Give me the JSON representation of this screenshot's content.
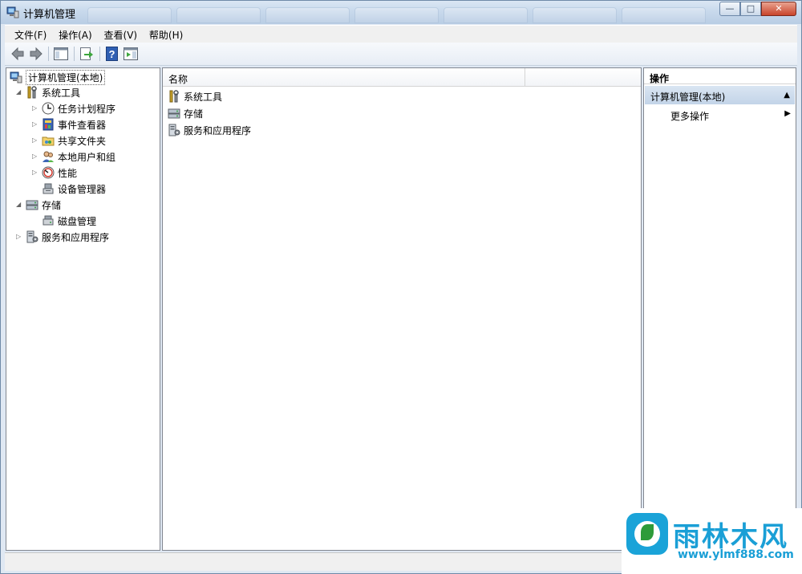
{
  "window": {
    "title": "计算机管理"
  },
  "menu": [
    "文件(F)",
    "操作(A)",
    "查看(V)",
    "帮助(H)"
  ],
  "tree": {
    "root": "计算机管理(本地)",
    "system_tools": "系统工具",
    "task_scheduler": "任务计划程序",
    "event_viewer": "事件查看器",
    "shared_folders": "共享文件夹",
    "local_users": "本地用户和组",
    "performance": "性能",
    "device_manager": "设备管理器",
    "storage": "存储",
    "disk_management": "磁盘管理",
    "services_apps": "服务和应用程序"
  },
  "list": {
    "column_name": "名称",
    "items": [
      "系统工具",
      "存储",
      "服务和应用程序"
    ]
  },
  "actions": {
    "title": "操作",
    "section": "计算机管理(本地)",
    "more": "更多操作"
  },
  "watermark": {
    "brand": "雨林木风",
    "url": "www.ylmf888.com"
  }
}
